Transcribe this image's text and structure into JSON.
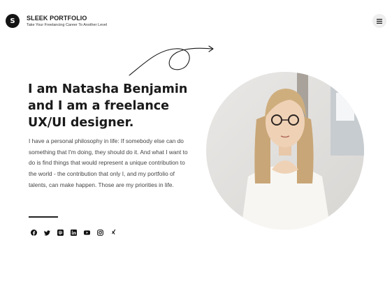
{
  "header": {
    "logo_letter": "S",
    "brand_name": "SLEEK PORTFOLIO",
    "tagline": "Take Your Freelancing Career To Another Level"
  },
  "hero": {
    "headline": "I am Natasha Benjamin and I am a freelance UX/UI designer.",
    "bio": "I have a personal philosophy in life: If somebody else can do something that I'm doing, they should do it. And what I want to do is find things that would represent a unique contribution to the world - the contribution that only I, and my portfolio of talents, can make happen. Those are my priorities in life."
  },
  "social_icons": [
    "facebook-icon",
    "twitter-icon",
    "pinterest-icon",
    "linkedin-icon",
    "youtube-icon",
    "instagram-icon",
    "xing-icon"
  ],
  "colors": {
    "text_dark": "#1a1a1a",
    "body_text": "#444444",
    "logo_bg": "#141414",
    "menu_bg": "#eeeeee"
  }
}
